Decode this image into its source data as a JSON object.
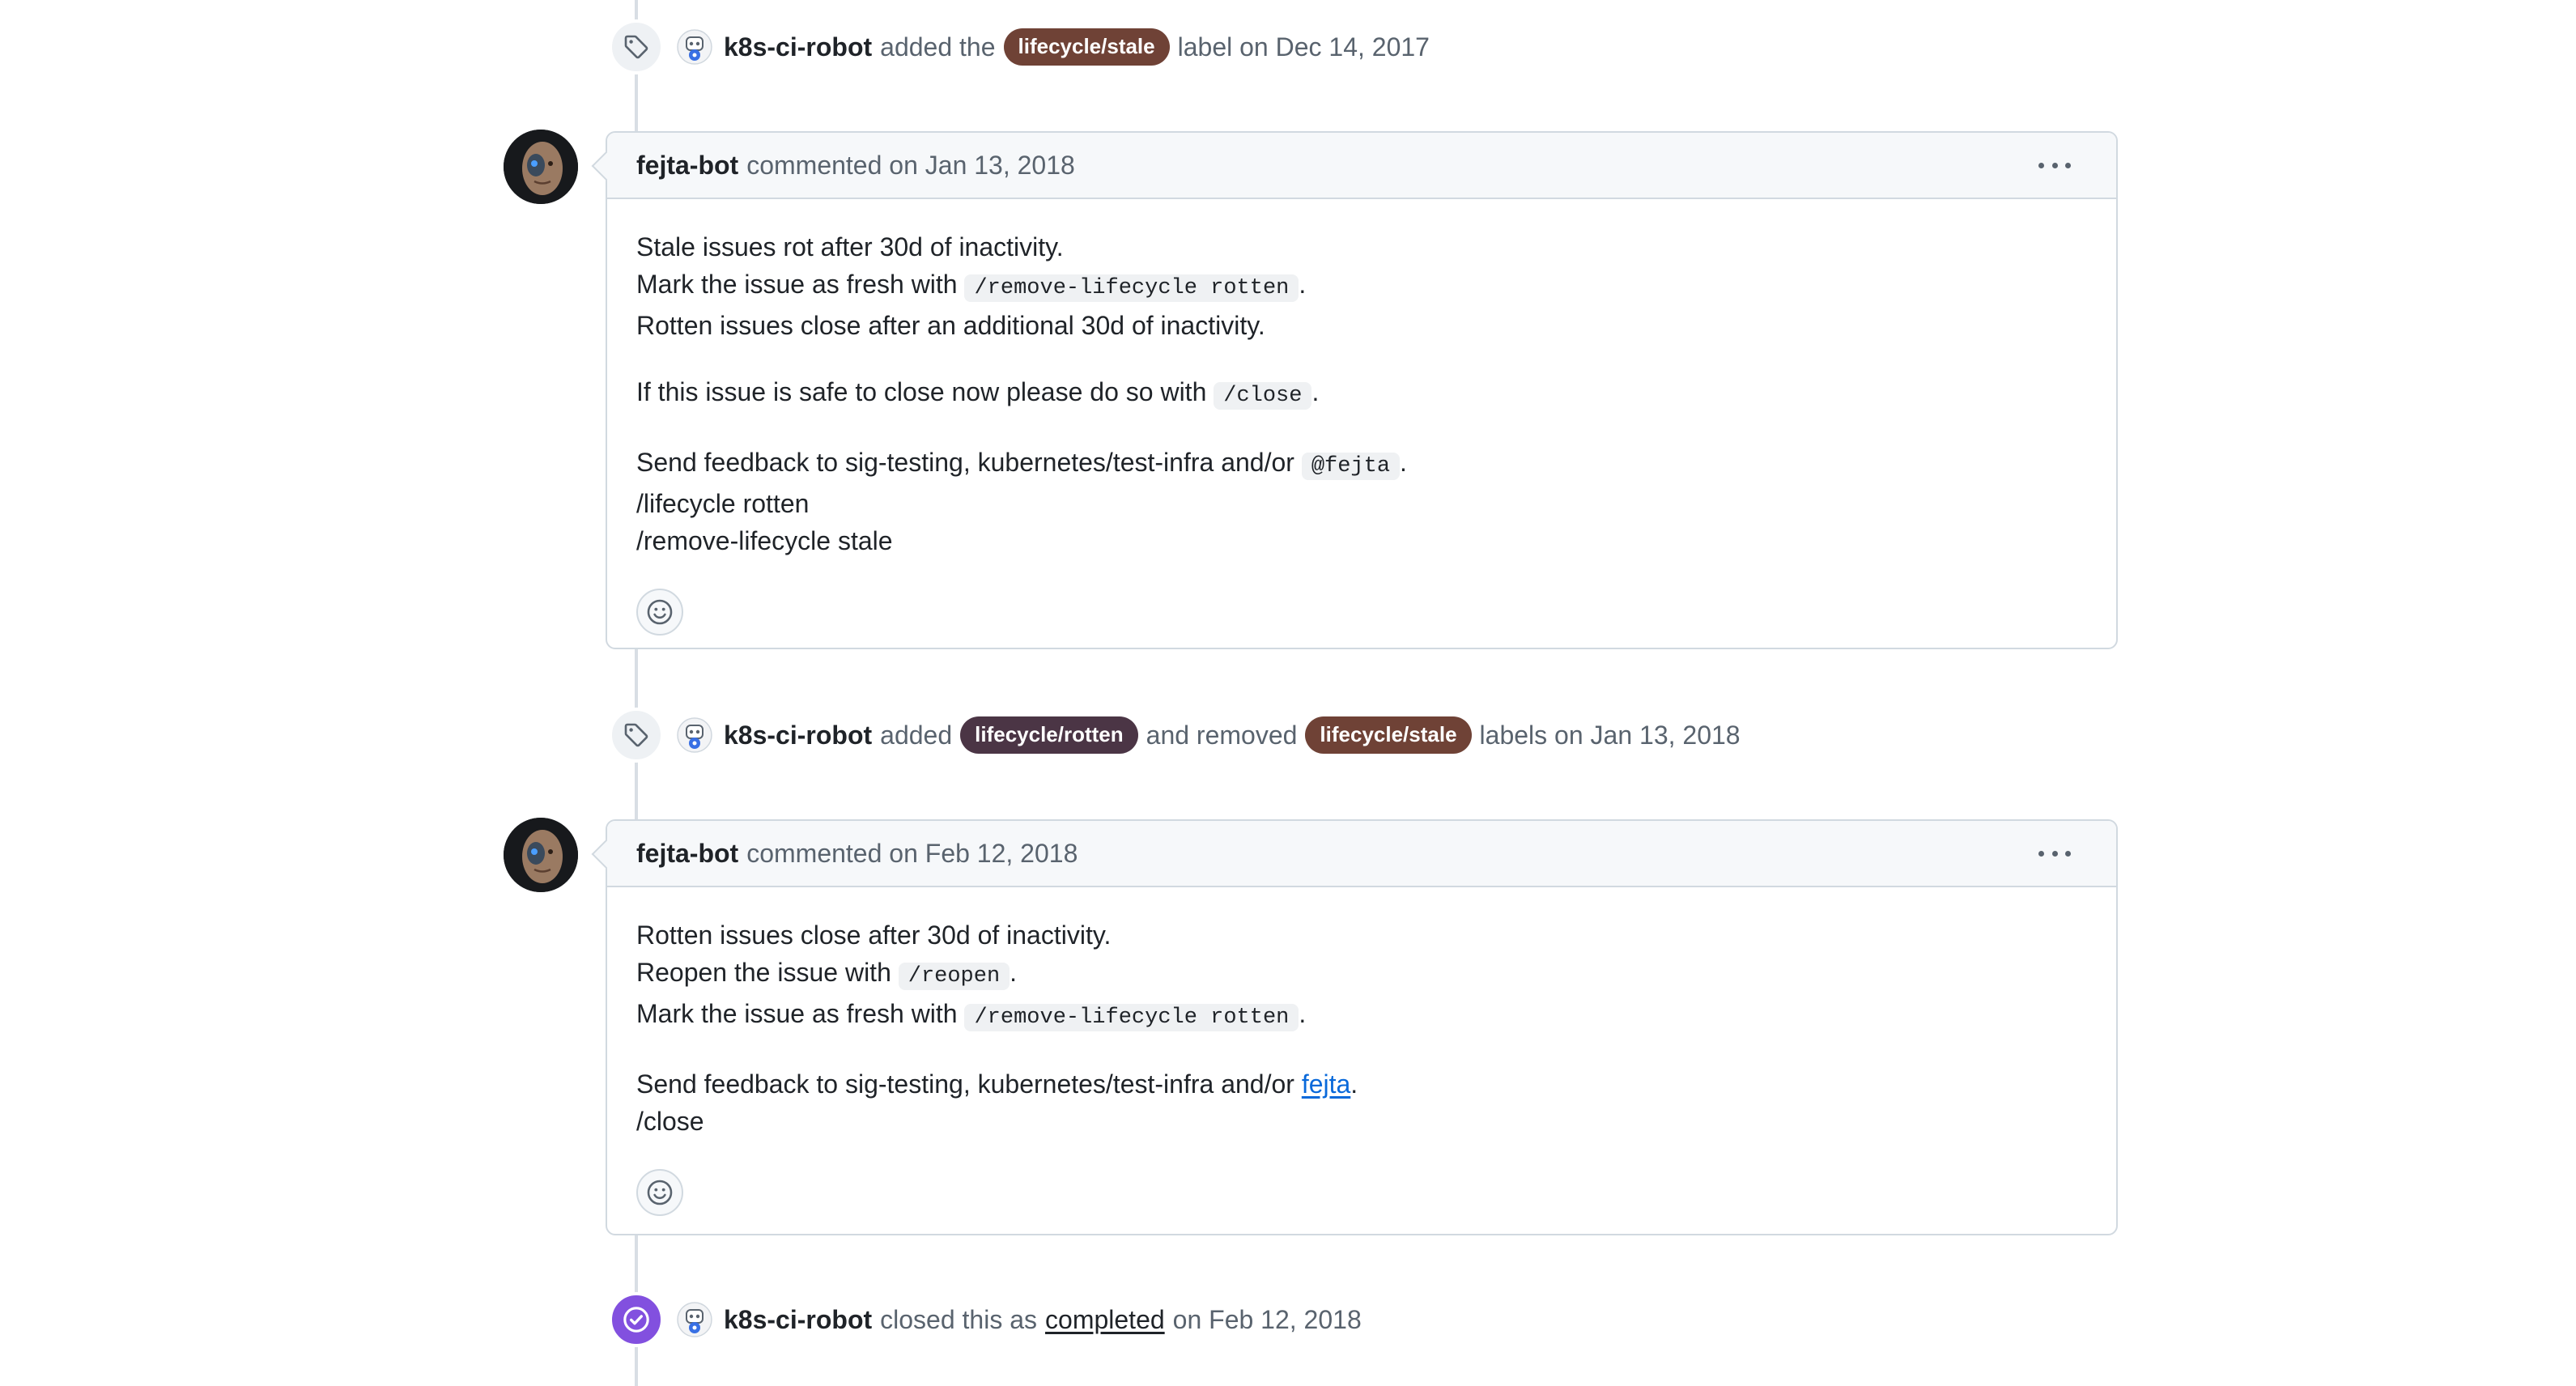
{
  "events": [
    {
      "actor": "k8s-ci-robot",
      "pre_text": "added the",
      "label": "lifecycle/stale",
      "post_text": "label on Dec 14, 2017"
    },
    {
      "actor": "k8s-ci-robot",
      "pre_text": "added",
      "label_added": "lifecycle/rotten",
      "mid_text": "and removed",
      "label_removed": "lifecycle/stale",
      "post_text": "labels on Jan 13, 2018"
    },
    {
      "actor": "k8s-ci-robot",
      "pre_text": "closed this as",
      "state_link": "completed",
      "post_text": "on Feb 12, 2018"
    }
  ],
  "comments": [
    {
      "author": "fejta-bot",
      "meta": "commented on Jan 13, 2018",
      "body": {
        "p1_l1": "Stale issues rot after 30d of inactivity.",
        "p1_l2_pre": "Mark the issue as fresh with",
        "p1_l2_code": "/remove-lifecycle rotten",
        "p1_l2_post": ".",
        "p1_l3": "Rotten issues close after an additional 30d of inactivity.",
        "p2_pre": "If this issue is safe to close now please do so with",
        "p2_code": "/close",
        "p2_post": ".",
        "p3_l1_pre": "Send feedback to sig-testing, kubernetes/test-infra and/or",
        "p3_l1_code": "@fejta",
        "p3_l1_post": ".",
        "p3_l2": "/lifecycle rotten",
        "p3_l3": "/remove-lifecycle stale"
      }
    },
    {
      "author": "fejta-bot",
      "meta": "commented on Feb 12, 2018",
      "body": {
        "p1_l1": "Rotten issues close after 30d of inactivity.",
        "p1_l2_pre": "Reopen the issue with",
        "p1_l2_code": "/reopen",
        "p1_l2_post": ".",
        "p1_l3_pre": "Mark the issue as fresh with",
        "p1_l3_code": "/remove-lifecycle rotten",
        "p1_l3_post": ".",
        "p2_l1_pre": "Send feedback to sig-testing, kubernetes/test-infra and/or",
        "p2_l1_link": "fejta",
        "p2_l1_post": ".",
        "p2_l2": "/close"
      }
    }
  ],
  "icons": {
    "label_event": "tag-icon",
    "closed_event": "check-circle-icon",
    "reaction": "smiley-icon",
    "menu": "kebab-horizontal-icon"
  },
  "colors": {
    "label_stale": "#6f4236",
    "label_rotten": "#4b3545",
    "closed_purple": "#8250df",
    "link_blue": "#0969da"
  }
}
